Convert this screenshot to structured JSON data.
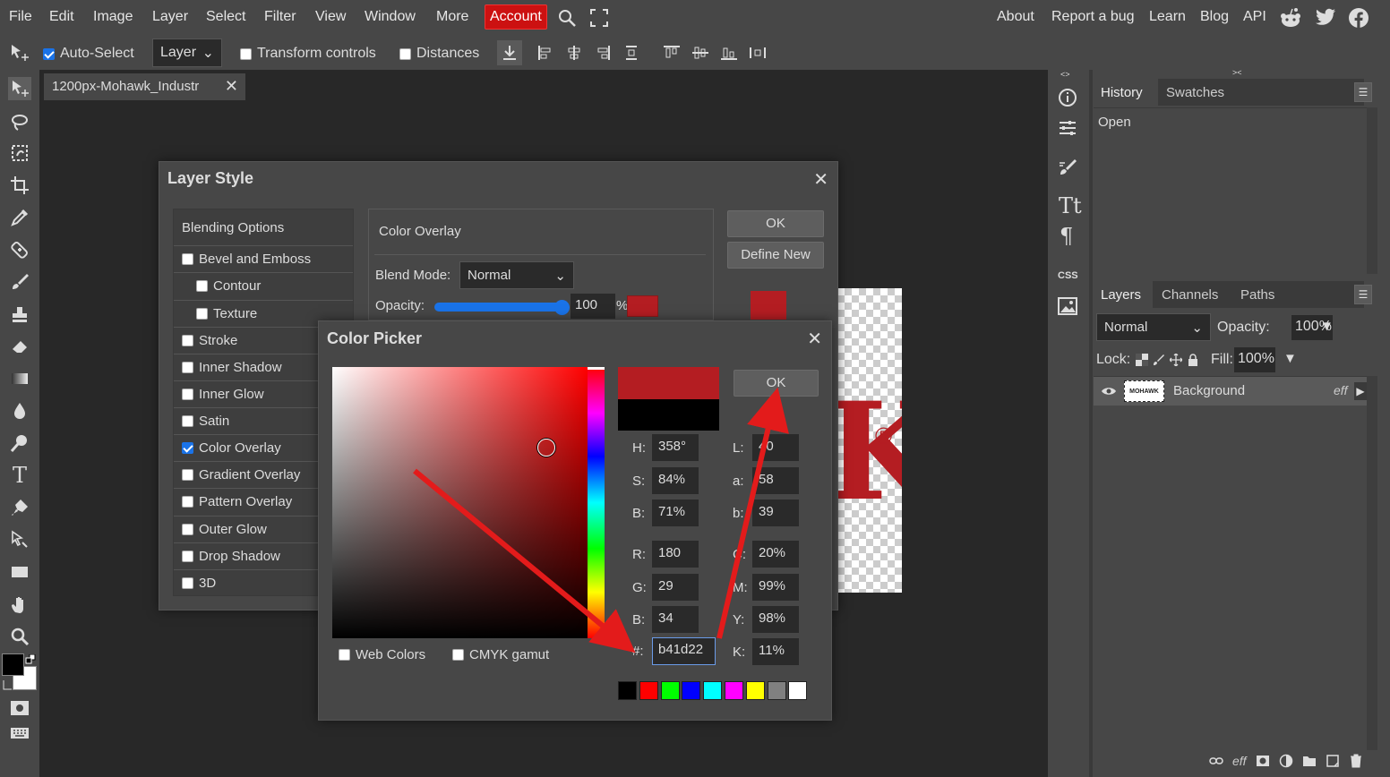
{
  "menu": {
    "items": [
      "File",
      "Edit",
      "Image",
      "Layer",
      "Select",
      "Filter",
      "View",
      "Window",
      "More"
    ],
    "account": "Account",
    "right": [
      "About",
      "Report a bug",
      "Learn",
      "Blog",
      "API"
    ]
  },
  "options": {
    "auto_select": "Auto-Select",
    "auto_select_mode": "Layer",
    "transform_controls": "Transform controls",
    "distances": "Distances"
  },
  "document_tab": {
    "title": "1200px-Mohawk_Industr"
  },
  "layer_style": {
    "title": "Layer Style",
    "items": [
      {
        "label": "Blending Options",
        "checkbox": false,
        "checked": false,
        "indent": false
      },
      {
        "label": "Bevel and Emboss",
        "checkbox": true,
        "checked": false,
        "indent": false
      },
      {
        "label": "Contour",
        "checkbox": true,
        "checked": false,
        "indent": true
      },
      {
        "label": "Texture",
        "checkbox": true,
        "checked": false,
        "indent": true
      },
      {
        "label": "Stroke",
        "checkbox": true,
        "checked": false,
        "indent": false
      },
      {
        "label": "Inner Shadow",
        "checkbox": true,
        "checked": false,
        "indent": false
      },
      {
        "label": "Inner Glow",
        "checkbox": true,
        "checked": false,
        "indent": false
      },
      {
        "label": "Satin",
        "checkbox": true,
        "checked": false,
        "indent": false
      },
      {
        "label": "Color Overlay",
        "checkbox": true,
        "checked": true,
        "indent": false
      },
      {
        "label": "Gradient Overlay",
        "checkbox": true,
        "checked": false,
        "indent": false
      },
      {
        "label": "Pattern Overlay",
        "checkbox": true,
        "checked": false,
        "indent": false
      },
      {
        "label": "Outer Glow",
        "checkbox": true,
        "checked": false,
        "indent": false
      },
      {
        "label": "Drop Shadow",
        "checkbox": true,
        "checked": false,
        "indent": false
      },
      {
        "label": "3D",
        "checkbox": true,
        "checked": false,
        "indent": false
      }
    ],
    "section_title": "Color Overlay",
    "blend_mode_label": "Blend Mode:",
    "blend_mode": "Normal",
    "opacity_label": "Opacity:",
    "opacity": "100",
    "opacity_unit": "%",
    "ok": "OK",
    "define_new": "Define New",
    "overlay_color": "#b41d22"
  },
  "color_picker": {
    "title": "Color Picker",
    "ok": "OK",
    "new_color": "#b41d22",
    "old_color": "#000000",
    "fields_left": [
      {
        "label": "H:",
        "value": "358°"
      },
      {
        "label": "S:",
        "value": "84%"
      },
      {
        "label": "B:",
        "value": "71%"
      },
      {
        "label": "R:",
        "value": "180"
      },
      {
        "label": "G:",
        "value": "29"
      },
      {
        "label": "B:",
        "value": "34"
      }
    ],
    "fields_right": [
      {
        "label": "L:",
        "value": "40"
      },
      {
        "label": "a:",
        "value": "58"
      },
      {
        "label": "b:",
        "value": "39"
      },
      {
        "label": "C:",
        "value": "20%"
      },
      {
        "label": "M:",
        "value": "99%"
      },
      {
        "label": "Y:",
        "value": "98%"
      },
      {
        "label": "K:",
        "value": "11%"
      }
    ],
    "hex_label": "#:",
    "hex": "b41d22",
    "web_colors": "Web Colors",
    "cmyk_gamut": "CMYK gamut",
    "swatches": [
      "#000000",
      "#ff0000",
      "#00ff00",
      "#0000ff",
      "#00ffff",
      "#ff00ff",
      "#ffff00",
      "#808080",
      "#ffffff"
    ]
  },
  "canvas_preview": {
    "logo_text": "K",
    "registered": "®",
    "logo_color": "#b41d22"
  },
  "right_panels": {
    "history_tabs": [
      "History",
      "Swatches"
    ],
    "history_items": [
      "Open"
    ],
    "layer_tabs": [
      "Layers",
      "Channels",
      "Paths"
    ],
    "blend_mode": "Normal",
    "opacity_label": "Opacity:",
    "opacity": "100%",
    "lock_label": "Lock:",
    "fill_label": "Fill:",
    "fill": "100%",
    "layer_name": "Background",
    "layer_fx": "eff",
    "footer_fx": "eff"
  }
}
